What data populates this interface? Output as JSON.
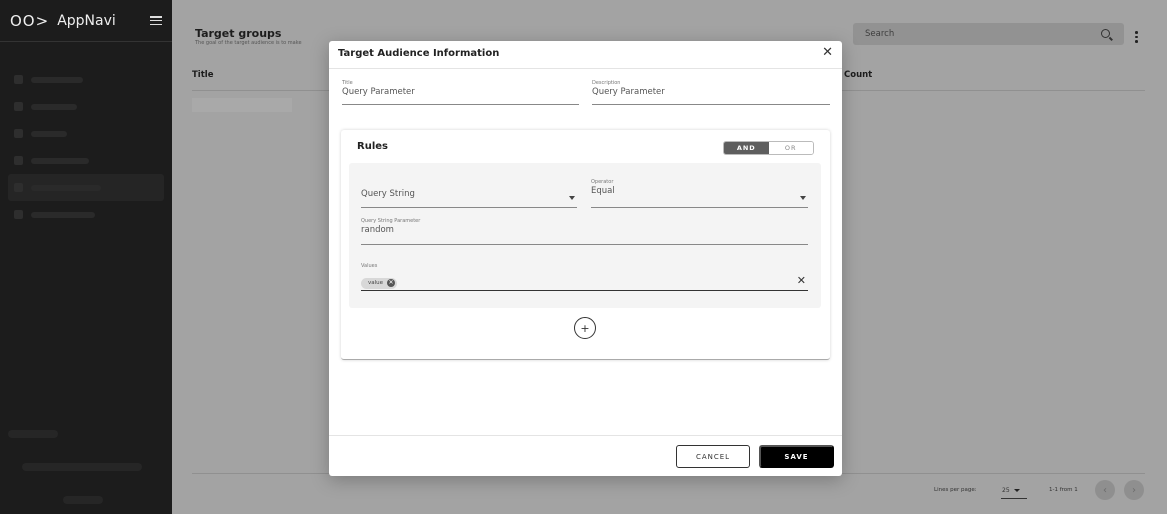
{
  "app": {
    "name": "AppNavi",
    "logo_mark": "OO>"
  },
  "page": {
    "title": "Target groups",
    "subtitle": "The goal of the target audience is to make",
    "search_placeholder": "Search",
    "table_headers": {
      "title": "Title",
      "count": "Count"
    },
    "pagination": {
      "lines_label": "Lines per page:",
      "lines_value": "25",
      "range": "1-1 from 1"
    }
  },
  "modal": {
    "title": "Target Audience Information",
    "fields": {
      "title_label": "Title",
      "title_value": "Query Parameter",
      "description_label": "Description",
      "description_value": "Query Parameter"
    },
    "rules": {
      "heading": "Rules",
      "toggle_and": "AND",
      "toggle_or": "OR",
      "selected": "AND",
      "rule": {
        "type_value": "Query String",
        "operator_label": "Operator",
        "operator_value": "Equal",
        "param_label": "Query String Parameter",
        "param_value": "random",
        "values_label": "Values",
        "chips": [
          "value"
        ]
      },
      "add_symbol": "+"
    },
    "buttons": {
      "cancel": "CANCEL",
      "save": "SAVE"
    }
  },
  "icons": {
    "close": "close-icon",
    "search": "search-icon",
    "menu": "menu-icon",
    "kebab": "more-vertical-icon",
    "add": "plus-circle-icon"
  },
  "colors": {
    "sidebar_bg": "#1c1c1c",
    "toggle_active": "#5e5e5e",
    "save_bg": "#000000"
  }
}
